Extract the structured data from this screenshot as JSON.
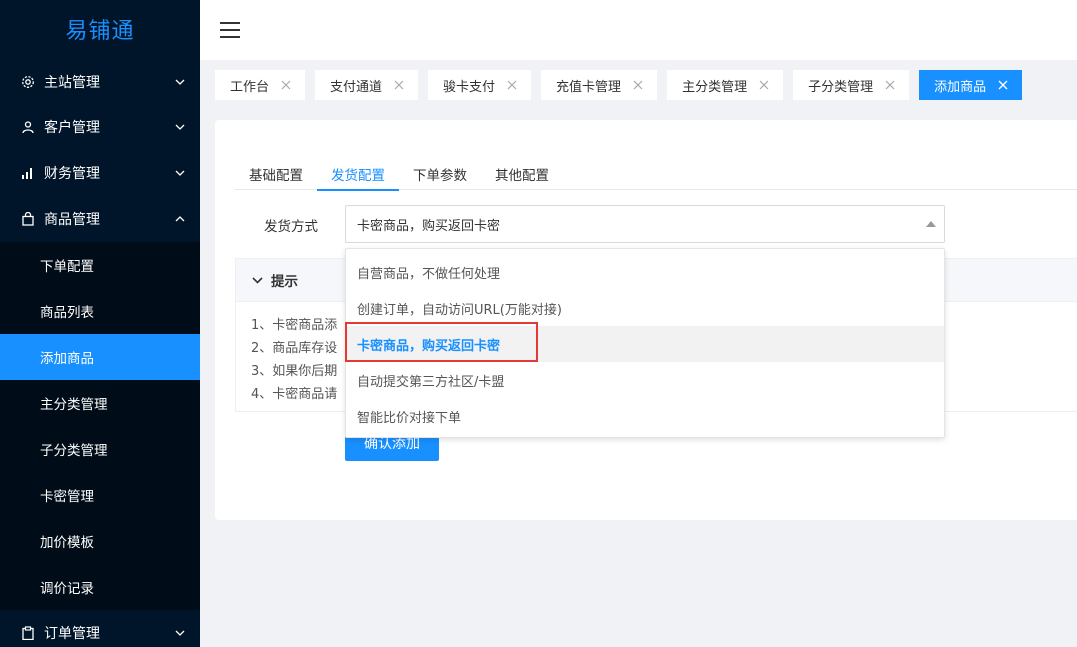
{
  "app": {
    "logo": "易铺通"
  },
  "sidebar": {
    "groups": [
      {
        "label": "主站管理",
        "icon": "gear-icon"
      },
      {
        "label": "客户管理",
        "icon": "user-icon"
      },
      {
        "label": "财务管理",
        "icon": "bar-chart-icon"
      },
      {
        "label": "商品管理",
        "icon": "shopping-bag-icon",
        "expanded": true
      },
      {
        "label": "订单管理",
        "icon": "clipboard-icon"
      }
    ],
    "sub_items": [
      "下单配置",
      "商品列表",
      "添加商品",
      "主分类管理",
      "子分类管理",
      "卡密管理",
      "加价模板",
      "调价记录"
    ],
    "active_sub": "添加商品"
  },
  "tabs": [
    {
      "label": "工作台"
    },
    {
      "label": "支付通道"
    },
    {
      "label": "骏卡支付"
    },
    {
      "label": "充值卡管理"
    },
    {
      "label": "主分类管理"
    },
    {
      "label": "子分类管理"
    },
    {
      "label": "添加商品",
      "active": true
    }
  ],
  "form": {
    "tabs": [
      "基础配置",
      "发货配置",
      "下单参数",
      "其他配置"
    ],
    "active_tab": "发货配置",
    "delivery": {
      "label": "发货方式",
      "value": "卡密商品，购买返回卡密",
      "options": [
        "自营商品，不做任何处理",
        "创建订单，自动访问URL(万能对接)",
        "卡密商品，购买返回卡密",
        "自动提交第三方社区/卡盟",
        "智能比价对接下单"
      ]
    },
    "tips": {
      "title": "提示",
      "lines": [
        "1、卡密商品添",
        "2、商品库存设",
        "3、如果你后期",
        "4、卡密商品请"
      ]
    },
    "submit_label": "确认添加"
  },
  "colors": {
    "primary": "#1890ff",
    "sidebar_bg": "#001529",
    "highlight": "#e53935"
  }
}
